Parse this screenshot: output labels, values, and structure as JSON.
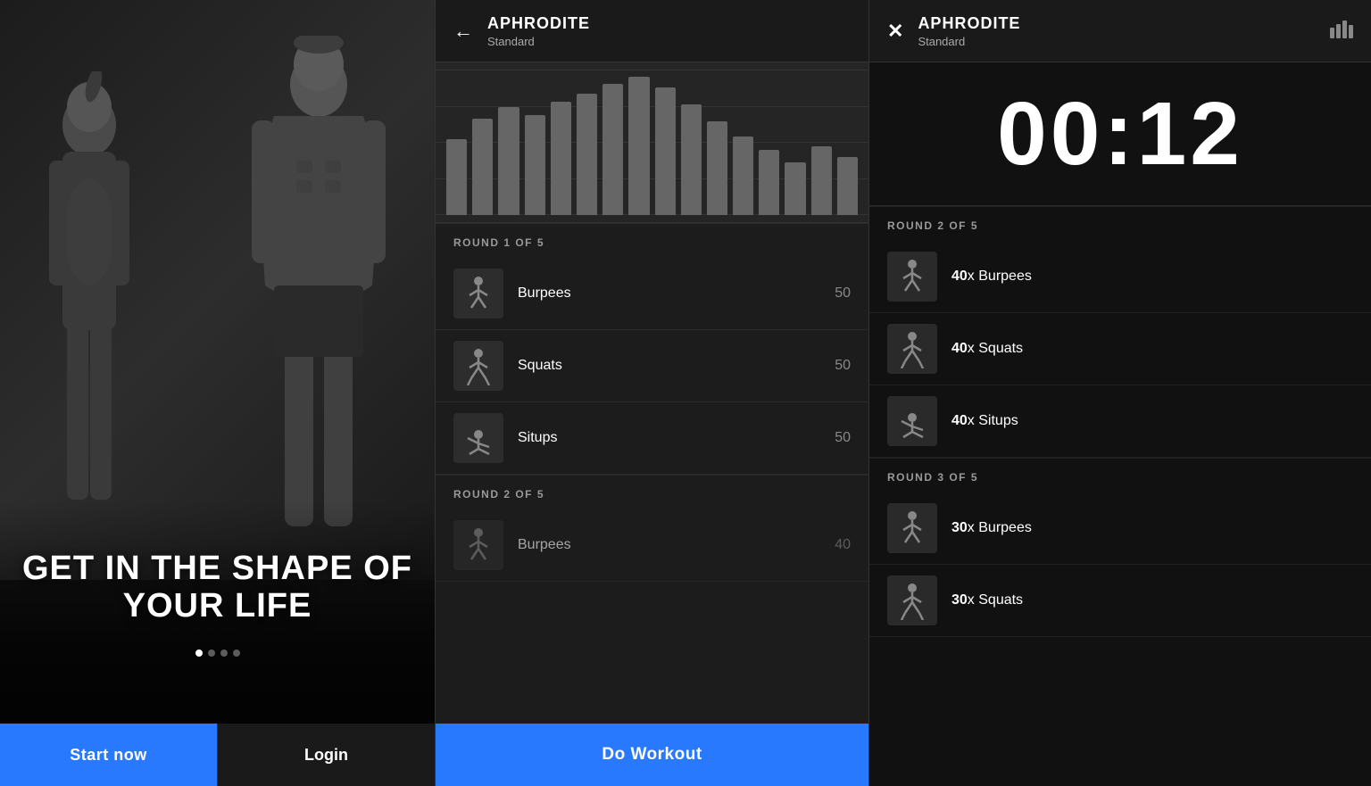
{
  "panel1": {
    "hero_text": "GET IN THE SHAPE OF YOUR LIFE",
    "btn_start": "Start now",
    "btn_login": "Login",
    "dots": [
      true,
      false,
      false,
      false
    ]
  },
  "panel2": {
    "header": {
      "workout_name": "APHRODITE",
      "workout_type": "Standard",
      "back_label": "←"
    },
    "chart": {
      "bars": [
        55,
        75,
        80,
        70,
        85,
        90,
        95,
        100,
        90,
        80,
        70,
        60,
        50,
        40,
        55,
        45
      ]
    },
    "rounds": [
      {
        "label": "ROUND 1 OF 5",
        "exercises": [
          {
            "name": "Burpees",
            "count": 50
          },
          {
            "name": "Squats",
            "count": 50
          },
          {
            "name": "Situps",
            "count": 50
          }
        ]
      },
      {
        "label": "ROUND 2 OF 5",
        "exercises": []
      }
    ],
    "btn_do_workout": "Do Workout"
  },
  "panel3": {
    "header": {
      "workout_name": "APHRODITE",
      "workout_type": "Standard",
      "close_label": "✕",
      "stats_label": "📊"
    },
    "timer": "00:12",
    "rounds": [
      {
        "label": "ROUND 2 OF 5",
        "exercises": [
          {
            "name": "Burpees",
            "count": 40
          },
          {
            "name": "Squats",
            "count": 40
          },
          {
            "name": "Situps",
            "count": 40
          }
        ]
      },
      {
        "label": "ROUND 3 OF 5",
        "exercises": [
          {
            "name": "Burpees",
            "count": 30
          },
          {
            "name": "Squats",
            "count": 30
          }
        ]
      }
    ]
  }
}
